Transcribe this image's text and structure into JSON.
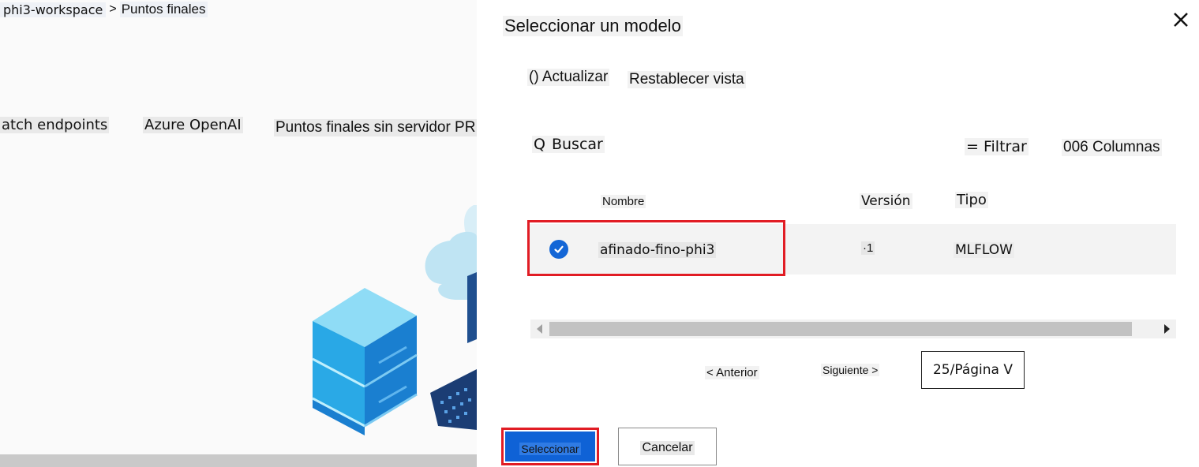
{
  "background": {
    "breadcrumb": {
      "workspace": "phi3-workspace",
      "separator": ">",
      "current": "Puntos finales"
    },
    "tabs": [
      {
        "label": "atch endpoints"
      },
      {
        "label": "Azure OpenAI"
      },
      {
        "label": "Puntos finales sin servidor PREVII"
      }
    ]
  },
  "panel": {
    "title": "Seleccionar un modelo",
    "close_icon": "close-icon",
    "toolbar": {
      "refresh_label": "() Actualizar",
      "reset_label": "Restablecer vista"
    },
    "search": {
      "icon": "Q",
      "label": "Buscar"
    },
    "filter_label": "= Filtrar",
    "columns_label": "006 Columnas",
    "table": {
      "headers": {
        "name": "Nombre",
        "version": "Versión",
        "type": "Tipo"
      },
      "rows": [
        {
          "selected": true,
          "name": "afinado-fino-phi3",
          "version": "·1",
          "type": "MLFLOW"
        }
      ]
    },
    "pagination": {
      "prev_label": "< Anterior",
      "next_label": "Siguiente >",
      "page_size": "25/Página V"
    },
    "buttons": {
      "select_label": "Seleccionar",
      "cancel_label": "Cancelar"
    },
    "colors": {
      "accent": "#0f62d6",
      "highlight": "#e11c24"
    }
  }
}
